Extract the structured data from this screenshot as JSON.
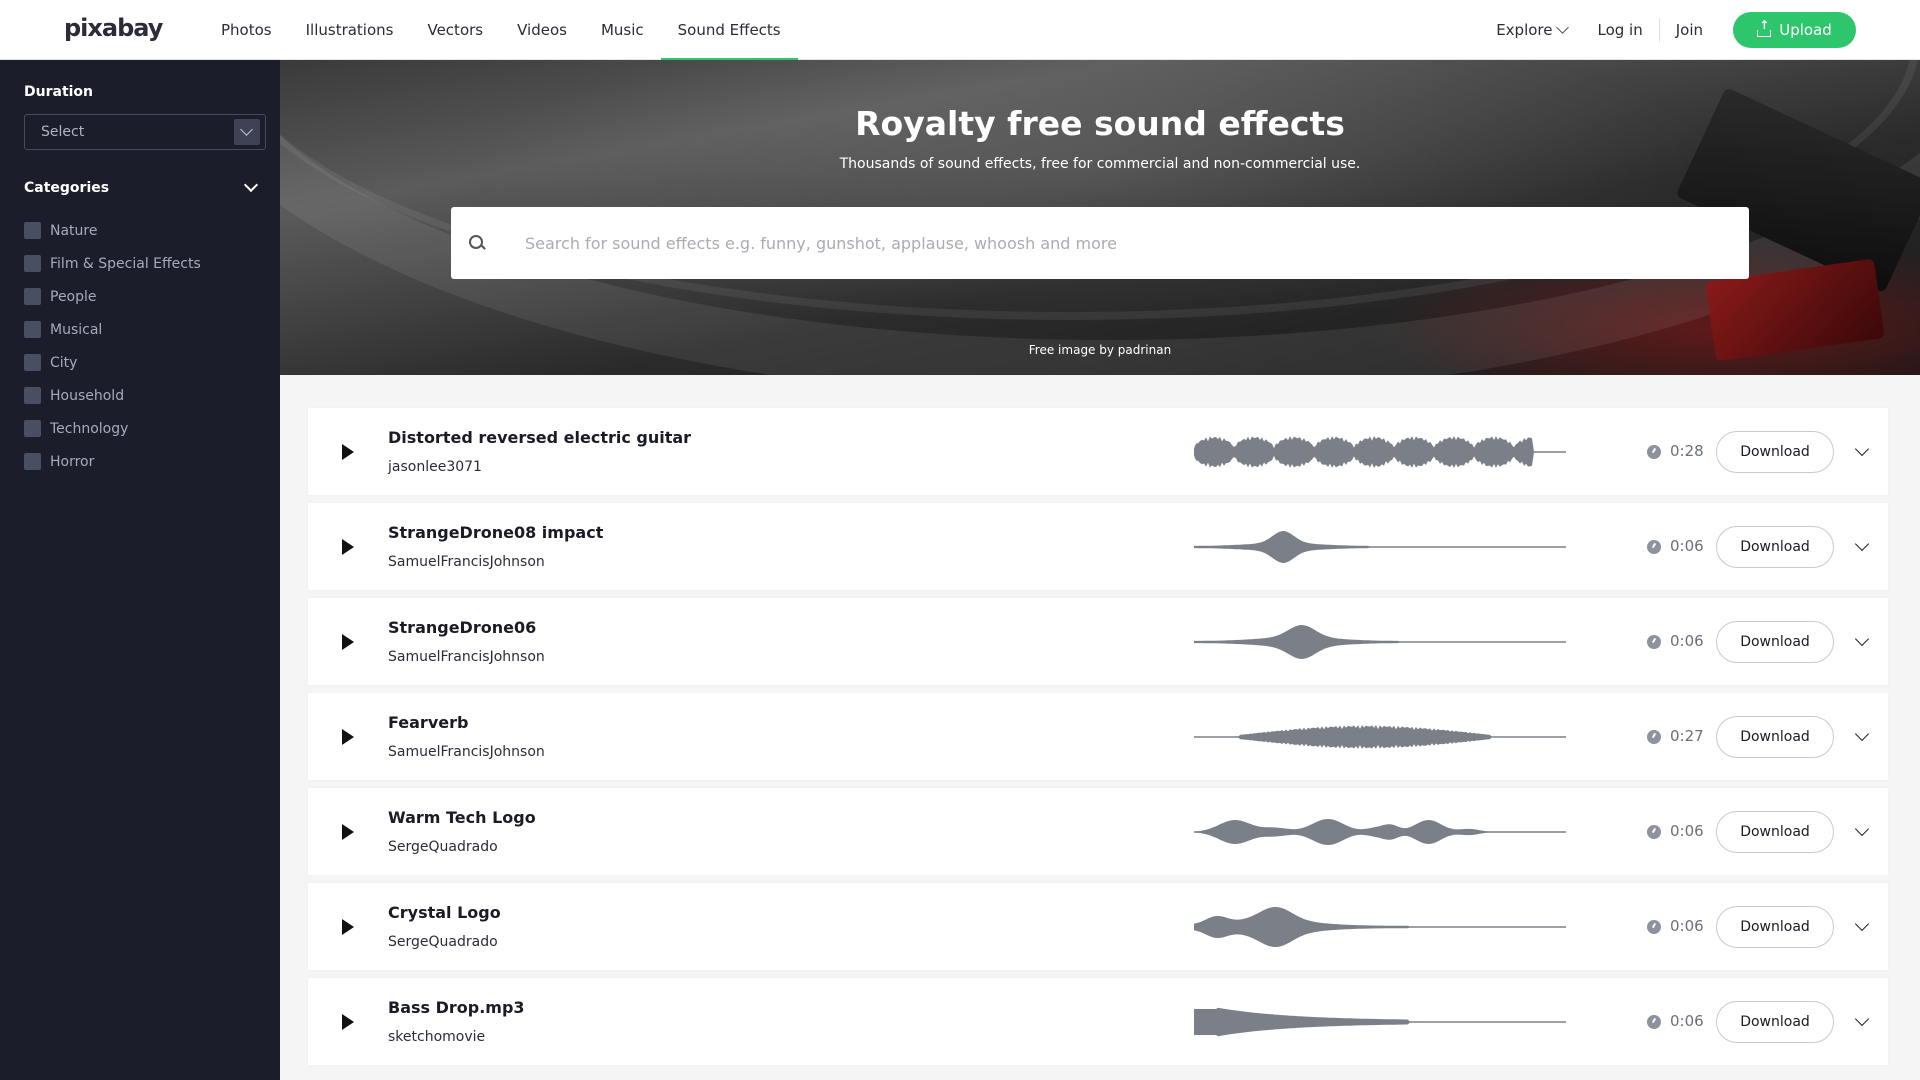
{
  "header": {
    "logo": "pixabay",
    "nav": [
      {
        "label": "Photos"
      },
      {
        "label": "Illustrations"
      },
      {
        "label": "Vectors"
      },
      {
        "label": "Videos"
      },
      {
        "label": "Music"
      },
      {
        "label": "Sound Effects",
        "active": true
      }
    ],
    "explore_label": "Explore",
    "login_label": "Log in",
    "join_label": "Join",
    "upload_label": "Upload",
    "accent_color": "#2ec66d"
  },
  "sidebar": {
    "duration_heading": "Duration",
    "duration_select_value": "Select",
    "categories_heading": "Categories",
    "categories": [
      {
        "label": "Nature",
        "checked": false
      },
      {
        "label": "Film & Special Effects",
        "checked": false
      },
      {
        "label": "People",
        "checked": false
      },
      {
        "label": "Musical",
        "checked": false
      },
      {
        "label": "City",
        "checked": false
      },
      {
        "label": "Household",
        "checked": false
      },
      {
        "label": "Technology",
        "checked": false
      },
      {
        "label": "Horror",
        "checked": false
      }
    ]
  },
  "hero": {
    "title": "Royalty free sound effects",
    "subtitle": "Thousands of sound effects, free for commercial and non-commercial use.",
    "search_placeholder": "Search for sound effects e.g. funny, gunshot, applause, whoosh and more",
    "search_value": "",
    "credit": "Free image by padrinan"
  },
  "sounds": [
    {
      "title": "Distorted reversed electric guitar",
      "author": "jasonlee3071",
      "duration": "0:28",
      "download_label": "Download",
      "waveform": "guitar"
    },
    {
      "title": "StrangeDrone08 impact",
      "author": "SamuelFrancisJohnson",
      "duration": "0:06",
      "download_label": "Download",
      "waveform": "impact"
    },
    {
      "title": "StrangeDrone06",
      "author": "SamuelFrancisJohnson",
      "duration": "0:06",
      "download_label": "Download",
      "waveform": "drone"
    },
    {
      "title": "Fearverb",
      "author": "SamuelFrancisJohnson",
      "duration": "0:27",
      "download_label": "Download",
      "waveform": "fearverb"
    },
    {
      "title": "Warm Tech Logo",
      "author": "SergeQuadrado",
      "duration": "0:06",
      "download_label": "Download",
      "waveform": "warmtech"
    },
    {
      "title": "Crystal Logo",
      "author": "SergeQuadrado",
      "duration": "0:06",
      "download_label": "Download",
      "waveform": "crystal"
    },
    {
      "title": "Bass Drop.mp3",
      "author": "sketchomovie",
      "duration": "0:06",
      "download_label": "Download",
      "waveform": "bassdrop"
    }
  ],
  "icons": [
    "search-icon",
    "play-icon",
    "clock-icon",
    "chevron-down-icon",
    "upload-icon"
  ],
  "colors": {
    "sidebar_bg": "#1b1d2b",
    "waveform": "#7b8088"
  }
}
